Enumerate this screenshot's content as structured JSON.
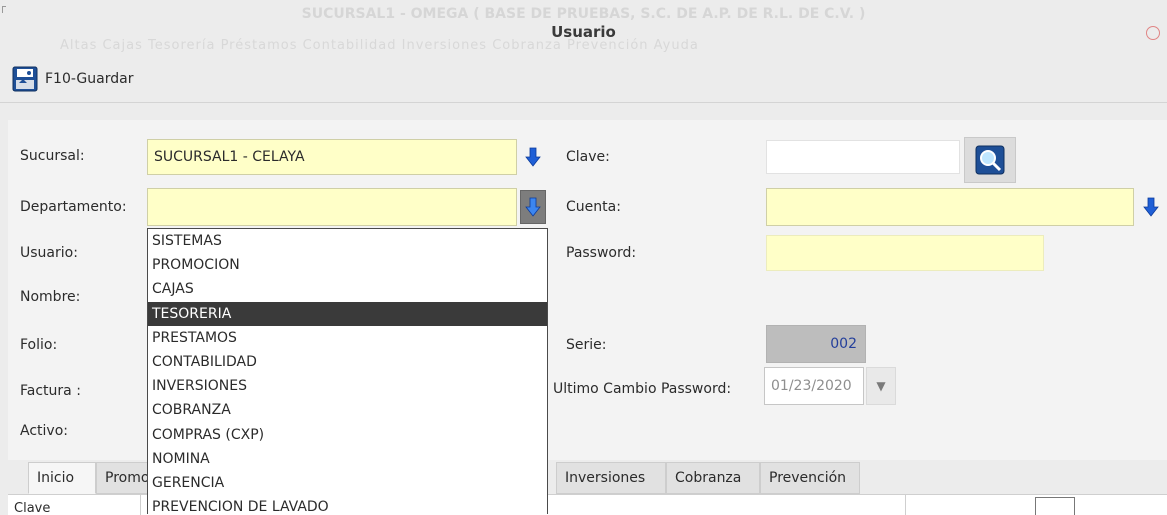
{
  "window": {
    "title": "Usuario",
    "bg_title": "SUCURSAL1 - OMEGA ( BASE DE PRUEBAS, S.C. DE A.P. DE R.L. DE C.V. )",
    "bg_menu": "Altas   Cajas   Tesorería   Préstamos   Contabilidad   Inversiones   Cobranza   Prevención   Ayuda"
  },
  "toolbar": {
    "save_label": "F10-Guardar",
    "save_icon": "save-disk-icon"
  },
  "form": {
    "sucursal_label": "Sucursal:",
    "sucursal_value": "SUCURSAL1 - CELAYA",
    "departamento_label": "Departamento:",
    "departamento_value": "",
    "usuario_label": "Usuario:",
    "nombre_label": "Nombre:",
    "folio_label": "Folio:",
    "factura_label": "Factura :",
    "activo_label": "Activo:",
    "clave_label": "Clave:",
    "clave_value": "",
    "cuenta_label": "Cuenta:",
    "cuenta_value": "",
    "password_label": "Password:",
    "password_value": "",
    "serie_label": "Serie:",
    "serie_value": "002",
    "ultimo_cambio_label": "Ultimo Cambio Password:",
    "ultimo_cambio_value": "01/23/2020"
  },
  "dropdown": {
    "items": [
      "SISTEMAS",
      "PROMOCION",
      "CAJAS",
      "TESORERIA",
      "PRESTAMOS",
      "CONTABILIDAD",
      "INVERSIONES",
      "COBRANZA",
      "COMPRAS (CXP)",
      "NOMINA",
      "GERENCIA",
      "PREVENCION DE LAVADO"
    ],
    "highlighted": "TESORERIA"
  },
  "tabs": [
    "Inicio",
    "Promoción",
    "Inversiones",
    "Cobranza",
    "Prevención"
  ],
  "table": {
    "first_header": "Clave"
  },
  "colors": {
    "field_yellow": "#ffffc8",
    "highlight": "#3a3a3a",
    "arrow_blue": "#1f5fd6"
  }
}
